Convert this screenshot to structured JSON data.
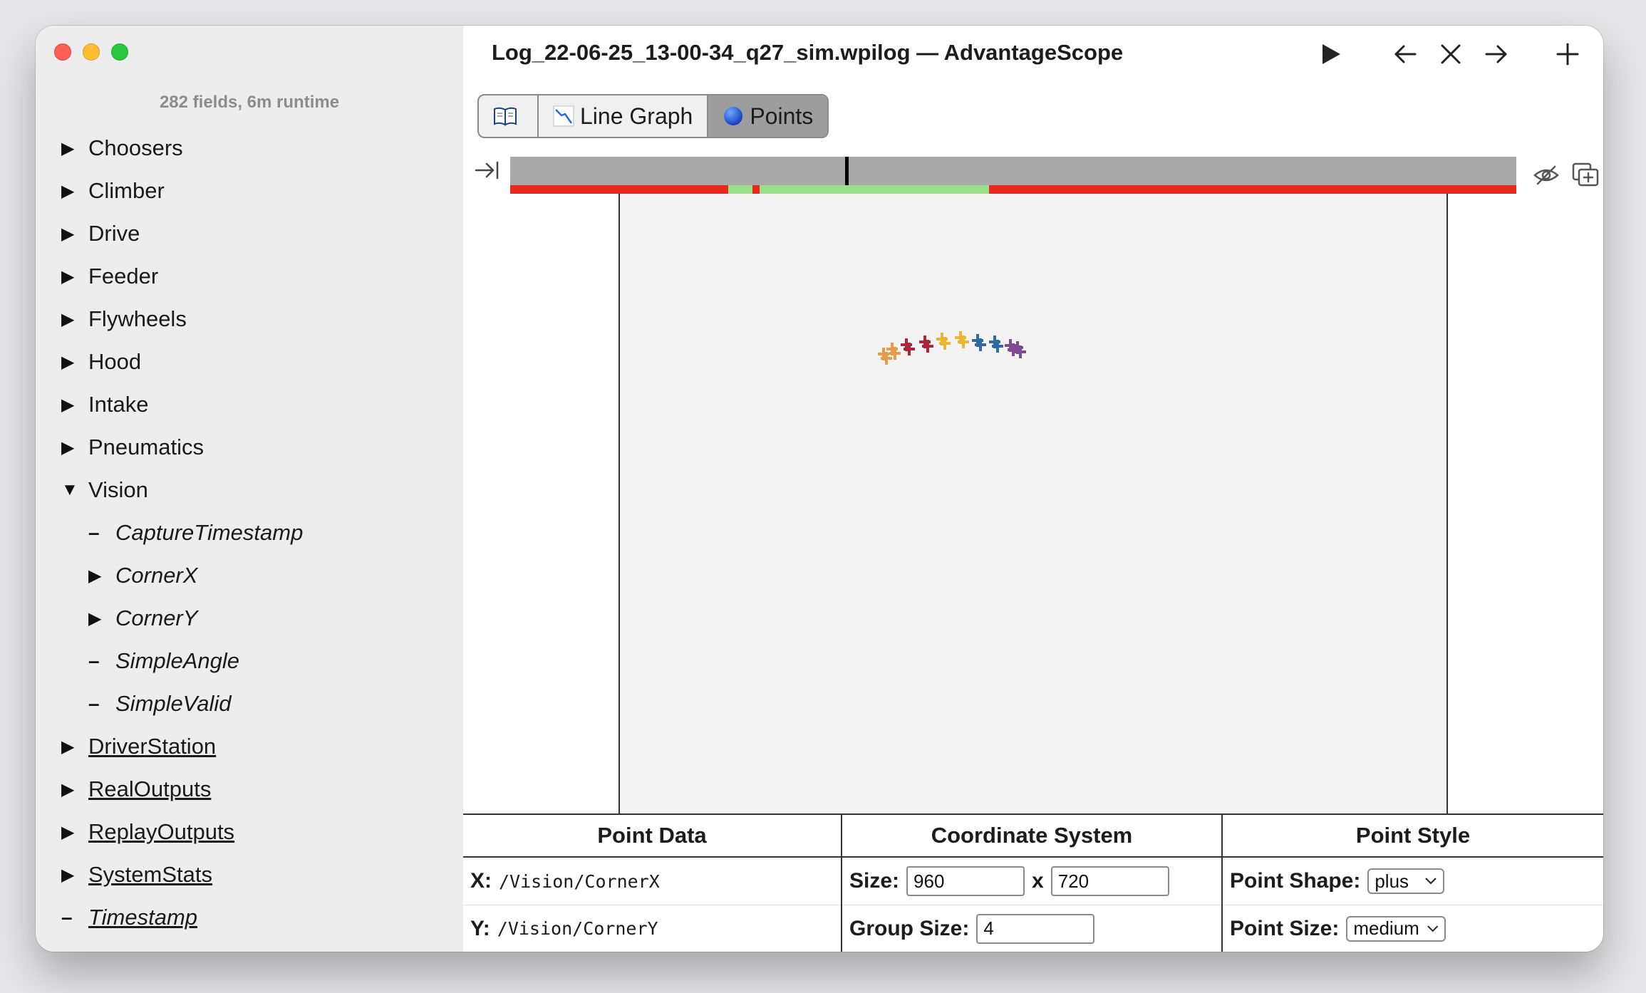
{
  "window": {
    "title": "Log_22-06-25_13-00-34_q27_sim.wpilog — AdvantageScope"
  },
  "sidebar": {
    "summary": "282 fields, 6m runtime",
    "items": [
      {
        "label": "Choosers",
        "icon": "triangle-right"
      },
      {
        "label": "Climber",
        "icon": "triangle-right"
      },
      {
        "label": "Drive",
        "icon": "triangle-right"
      },
      {
        "label": "Feeder",
        "icon": "triangle-right"
      },
      {
        "label": "Flywheels",
        "icon": "triangle-right"
      },
      {
        "label": "Hood",
        "icon": "triangle-right"
      },
      {
        "label": "Intake",
        "icon": "triangle-right"
      },
      {
        "label": "Pneumatics",
        "icon": "triangle-right"
      },
      {
        "label": "Vision",
        "icon": "triangle-down"
      },
      {
        "label": "CaptureTimestamp",
        "icon": "dash"
      },
      {
        "label": "CornerX",
        "icon": "triangle-right"
      },
      {
        "label": "CornerY",
        "icon": "triangle-right"
      },
      {
        "label": "SimpleAngle",
        "icon": "dash"
      },
      {
        "label": "SimpleValid",
        "icon": "dash"
      },
      {
        "label": "DriverStation",
        "icon": "triangle-right"
      },
      {
        "label": "RealOutputs",
        "icon": "triangle-right"
      },
      {
        "label": "ReplayOutputs",
        "icon": "triangle-right"
      },
      {
        "label": "SystemStats",
        "icon": "triangle-right"
      },
      {
        "label": "Timestamp",
        "icon": "dash"
      }
    ]
  },
  "tabs": [
    {
      "label": "",
      "icon": "book-icon"
    },
    {
      "label": "Line Graph",
      "icon": "line-chart-icon"
    },
    {
      "label": "Points",
      "icon": "blue-circle-icon",
      "active": true
    }
  ],
  "timeline": {
    "enabled_color": "#e8281c",
    "auto_color": "#9be08a"
  },
  "points": {
    "colors": [
      "#e69d4a",
      "#a8283a",
      "#e8b534",
      "#2f6aa3",
      "#7f4a92"
    ]
  },
  "config": {
    "point_data": {
      "header": "Point Data",
      "x_label": "X:",
      "x_value": "/Vision/CornerX",
      "y_label": "Y:",
      "y_value": "/Vision/CornerY"
    },
    "coordinate_system": {
      "header": "Coordinate System",
      "size_label": "Size:",
      "width": "960",
      "times": "x",
      "height": "720",
      "group_label": "Group Size:",
      "group_size": "4"
    },
    "point_style": {
      "header": "Point Style",
      "shape_label": "Point Shape:",
      "shape_value": "plus",
      "size_label": "Point Size:",
      "size_value": "medium"
    }
  }
}
